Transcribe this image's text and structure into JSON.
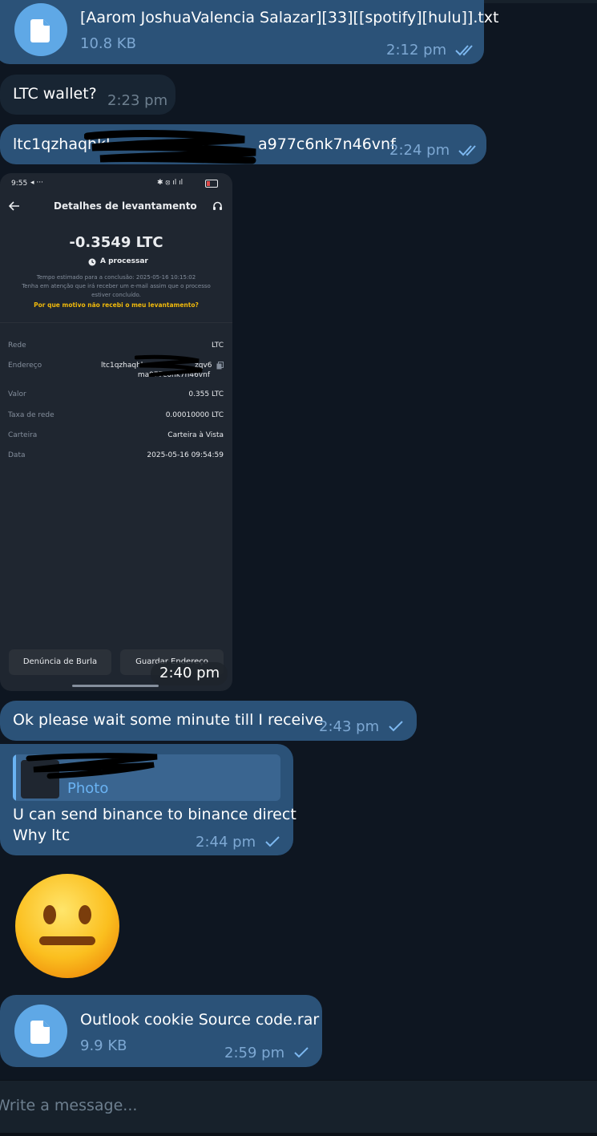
{
  "messages": {
    "file1": {
      "name": "[Aarom JoshuaValencia Salazar][33][[spotify][hulu]].txt",
      "size": "10.8 KB",
      "time": "2:12 pm"
    },
    "ltc_wallet": {
      "text": "LTC wallet?",
      "time": "2:23 pm"
    },
    "address": {
      "text": "ltc1qzhaqhkl",
      "text_tail": "a977c6nk7n46vnf",
      "time": "2:24 pm"
    },
    "photo": {
      "time": "2:40 pm"
    },
    "wait": {
      "text": "Ok please wait some minute till I receive",
      "time": "2:43 pm"
    },
    "reply": {
      "quote_type": "Photo",
      "line1": "U can send binance to binance direct",
      "line2": "Why ltc",
      "time": "2:44 pm"
    },
    "emoji": {
      "name": "neutral-face"
    },
    "file2": {
      "name": "Outlook cookie Source code.rar",
      "size": "9.9 KB",
      "time": "2:59 pm"
    }
  },
  "phone_screenshot": {
    "status_time": "9:55",
    "status_extra": "◂ ···",
    "battery": "9",
    "title": "Detalhes de levantamento",
    "amount": "-0.3549 LTC",
    "status": "A processar",
    "estimate_line": "Tempo estimado para a conclusão: 2025-05-16 10:15:02",
    "notice_line1": "Tenha em atenção que irá receber um e-mail assim que o processo",
    "notice_line2": "estiver concluído.",
    "link": "Por que motivo não recebi o meu levantamento?",
    "rows": {
      "rede": {
        "label": "Rede",
        "value": "LTC"
      },
      "endereco": {
        "label": "Endereço",
        "value1": "ltc1qzhaqhl",
        "value1_tail": "zqv6",
        "value2": "ma977c6nk7n46vnf"
      },
      "valor": {
        "label": "Valor",
        "value": "0.355 LTC"
      },
      "taxa": {
        "label": "Taxa de rede",
        "value": "0.00010000 LTC"
      },
      "carteira": {
        "label": "Carteira",
        "value": "Carteira à Vista"
      },
      "data": {
        "label": "Data",
        "value": "2025-05-16 09:54:59"
      }
    },
    "buttons": {
      "report": "Denúncia de Burla",
      "save": "Guardar Endereço"
    }
  },
  "composer": {
    "placeholder": "Write a message..."
  },
  "colors": {
    "background": "#0e1621",
    "outgoing_bubble": "#2b5278",
    "incoming_bubble": "#182533",
    "accent": "#5fa8e6",
    "binance_yellow": "#f0b90b"
  },
  "icons": [
    "file-icon",
    "double-check-icon",
    "single-check-icon",
    "back-arrow-icon",
    "headset-icon",
    "clock-icon",
    "copy-icon"
  ]
}
